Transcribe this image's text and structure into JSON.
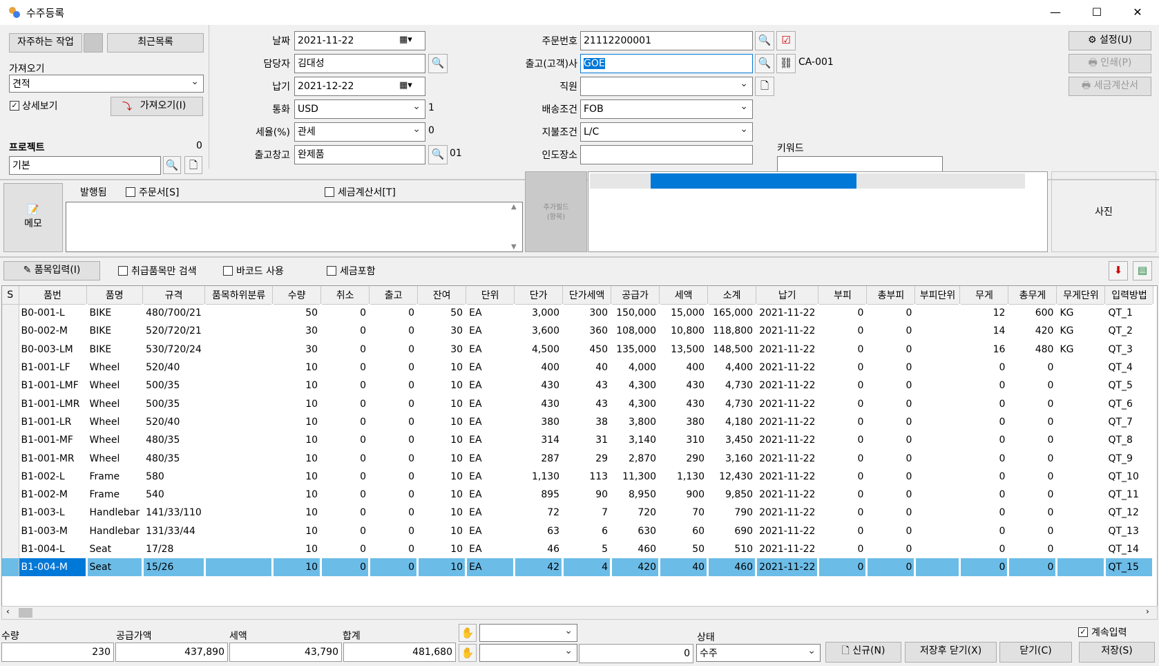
{
  "window": {
    "title": "수주등록",
    "minimize": "—",
    "maximize": "☐",
    "close": "✕"
  },
  "left": {
    "frequent_tasks": "자주하는 작업",
    "recent_list": "최근목록",
    "import_from_label": "가져오기",
    "import_from_value": "견적",
    "detail_view_label": "상세보기",
    "detail_view_checked": true,
    "import_button": "가져오기(I)",
    "project_label": "프로젝트",
    "project_count": "0",
    "project_value": "기본"
  },
  "form": {
    "date_label": "날짜",
    "date_value": "2021-11-22",
    "manager_label": "담당자",
    "manager_value": "김대성",
    "due_label": "납기",
    "due_value": "2021-12-22",
    "currency_label": "통화",
    "currency_value": "USD",
    "currency_rate": "1",
    "tax_label": "세율(%)",
    "tax_value": "관세",
    "tax_rate": "0",
    "warehouse_label": "출고창고",
    "warehouse_value": "완제품",
    "warehouse_code": "01",
    "order_no_label": "주문번호",
    "order_no_value": "21112200001",
    "customer_label": "출고(고객)사",
    "customer_value": "GOE",
    "customer_code": "CA-001",
    "staff_label": "직원",
    "staff_value": "",
    "shipping_label": "배송조건",
    "shipping_value": "FOB",
    "payment_label": "지불조건",
    "payment_value": "L/C",
    "delivery_place_label": "인도장소",
    "delivery_place_value": "",
    "keyword_label": "키워드",
    "keyword_value": ""
  },
  "right_buttons": {
    "settings": "설정(U)",
    "print": "인쇄(P)",
    "tax_invoice": "세금계산서"
  },
  "memo": {
    "button": "메모",
    "issued": "발행됨",
    "order_sheet": "주문서[S]",
    "tax_invoice": "세금계산서[T]",
    "extra_field": "추가필드",
    "extra_field_sub": "(항목)",
    "photo": "사진",
    "progress": 0.64
  },
  "toolbar": {
    "item_input": "품목입력(I)",
    "handled_only": "취급품목만 검색",
    "barcode": "바코드 사용",
    "tax_included": "세금포함"
  },
  "grid": {
    "columns": [
      "S",
      "품번",
      "품명",
      "규격",
      "품목하위분류",
      "수량",
      "취소",
      "출고",
      "잔여",
      "단위",
      "단가",
      "단가세액",
      "공급가",
      "세액",
      "소계",
      "납기",
      "부피",
      "총부피",
      "부피단위",
      "무게",
      "총무게",
      "무게단위",
      "입력방법"
    ],
    "rows": [
      [
        "",
        "B0-001-L",
        "BIKE",
        "480/700/21",
        "",
        "50",
        "0",
        "0",
        "50",
        "EA",
        "3,000",
        "300",
        "150,000",
        "15,000",
        "165,000",
        "2021-11-22",
        "0",
        "0",
        "",
        "12",
        "600",
        "KG",
        "QT_1"
      ],
      [
        "",
        "B0-002-M",
        "BIKE",
        "520/720/21",
        "",
        "30",
        "0",
        "0",
        "30",
        "EA",
        "3,600",
        "360",
        "108,000",
        "10,800",
        "118,800",
        "2021-11-22",
        "0",
        "0",
        "",
        "14",
        "420",
        "KG",
        "QT_2"
      ],
      [
        "",
        "B0-003-LM",
        "BIKE",
        "530/720/24",
        "",
        "30",
        "0",
        "0",
        "30",
        "EA",
        "4,500",
        "450",
        "135,000",
        "13,500",
        "148,500",
        "2021-11-22",
        "0",
        "0",
        "",
        "16",
        "480",
        "KG",
        "QT_3"
      ],
      [
        "",
        "B1-001-LF",
        "Wheel",
        "520/40",
        "",
        "10",
        "0",
        "0",
        "10",
        "EA",
        "400",
        "40",
        "4,000",
        "400",
        "4,400",
        "2021-11-22",
        "0",
        "0",
        "",
        "0",
        "0",
        "",
        "QT_4"
      ],
      [
        "",
        "B1-001-LMF",
        "Wheel",
        "500/35",
        "",
        "10",
        "0",
        "0",
        "10",
        "EA",
        "430",
        "43",
        "4,300",
        "430",
        "4,730",
        "2021-11-22",
        "0",
        "0",
        "",
        "0",
        "0",
        "",
        "QT_5"
      ],
      [
        "",
        "B1-001-LMR",
        "Wheel",
        "500/35",
        "",
        "10",
        "0",
        "0",
        "10",
        "EA",
        "430",
        "43",
        "4,300",
        "430",
        "4,730",
        "2021-11-22",
        "0",
        "0",
        "",
        "0",
        "0",
        "",
        "QT_6"
      ],
      [
        "",
        "B1-001-LR",
        "Wheel",
        "520/40",
        "",
        "10",
        "0",
        "0",
        "10",
        "EA",
        "380",
        "38",
        "3,800",
        "380",
        "4,180",
        "2021-11-22",
        "0",
        "0",
        "",
        "0",
        "0",
        "",
        "QT_7"
      ],
      [
        "",
        "B1-001-MF",
        "Wheel",
        "480/35",
        "",
        "10",
        "0",
        "0",
        "10",
        "EA",
        "314",
        "31",
        "3,140",
        "310",
        "3,450",
        "2021-11-22",
        "0",
        "0",
        "",
        "0",
        "0",
        "",
        "QT_8"
      ],
      [
        "",
        "B1-001-MR",
        "Wheel",
        "480/35",
        "",
        "10",
        "0",
        "0",
        "10",
        "EA",
        "287",
        "29",
        "2,870",
        "290",
        "3,160",
        "2021-11-22",
        "0",
        "0",
        "",
        "0",
        "0",
        "",
        "QT_9"
      ],
      [
        "",
        "B1-002-L",
        "Frame",
        "580",
        "",
        "10",
        "0",
        "0",
        "10",
        "EA",
        "1,130",
        "113",
        "11,300",
        "1,130",
        "12,430",
        "2021-11-22",
        "0",
        "0",
        "",
        "0",
        "0",
        "",
        "QT_10"
      ],
      [
        "",
        "B1-002-M",
        "Frame",
        "540",
        "",
        "10",
        "0",
        "0",
        "10",
        "EA",
        "895",
        "90",
        "8,950",
        "900",
        "9,850",
        "2021-11-22",
        "0",
        "0",
        "",
        "0",
        "0",
        "",
        "QT_11"
      ],
      [
        "",
        "B1-003-L",
        "Handlebar",
        "141/33/110",
        "",
        "10",
        "0",
        "0",
        "10",
        "EA",
        "72",
        "7",
        "720",
        "70",
        "790",
        "2021-11-22",
        "0",
        "0",
        "",
        "0",
        "0",
        "",
        "QT_12"
      ],
      [
        "",
        "B1-003-M",
        "Handlebar",
        "131/33/44",
        "",
        "10",
        "0",
        "0",
        "10",
        "EA",
        "63",
        "6",
        "630",
        "60",
        "690",
        "2021-11-22",
        "0",
        "0",
        "",
        "0",
        "0",
        "",
        "QT_13"
      ],
      [
        "",
        "B1-004-L",
        "Seat",
        "17/28",
        "",
        "10",
        "0",
        "0",
        "10",
        "EA",
        "46",
        "5",
        "460",
        "50",
        "510",
        "2021-11-22",
        "0",
        "0",
        "",
        "0",
        "0",
        "",
        "QT_14"
      ],
      [
        "",
        "B1-004-M",
        "Seat",
        "15/26",
        "",
        "10",
        "0",
        "0",
        "10",
        "EA",
        "42",
        "4",
        "420",
        "40",
        "460",
        "2021-11-22",
        "0",
        "0",
        "",
        "0",
        "0",
        "",
        "QT_15"
      ]
    ]
  },
  "footer": {
    "qty_label": "수량",
    "qty_value": "230",
    "supply_label": "공급가액",
    "supply_value": "437,890",
    "tax_label": "세액",
    "tax_value": "43,790",
    "total_label": "합계",
    "total_value": "481,680",
    "extra_value": "0",
    "status_label": "상태",
    "status_value": "수주",
    "continuous_input": "계속입력",
    "continuous_checked": true,
    "new_button": "신규(N)",
    "save_close_button": "저장후 닫기(X)",
    "close_button": "닫기(C)",
    "save_button": "저장(S)"
  },
  "colors": {
    "accent": "#0078d7",
    "selection": "#6cbce8"
  }
}
